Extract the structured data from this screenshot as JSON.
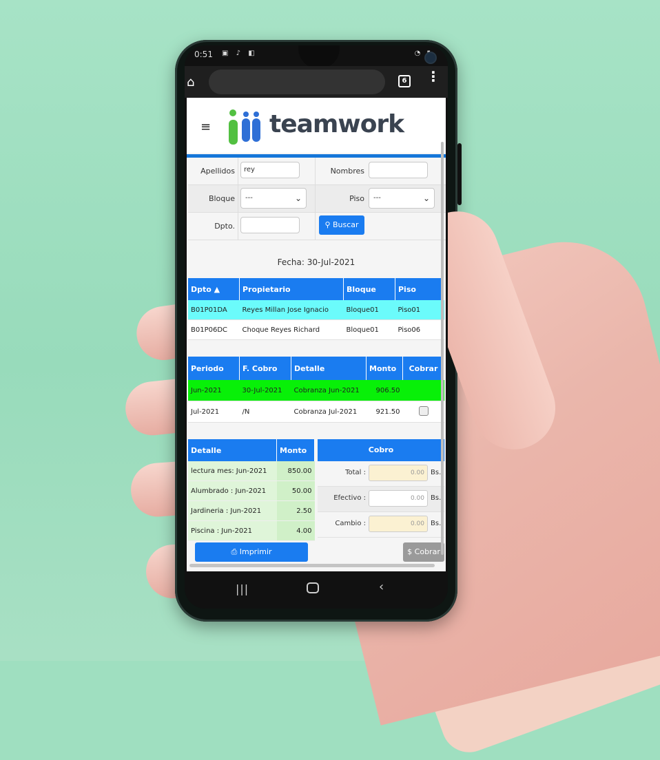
{
  "status": {
    "time": "0:51",
    "notif_icons": "▣ ♪ ◧",
    "right_icons": "◔ ▮"
  },
  "browser": {
    "tab_count": "6",
    "home": "⌂",
    "menu": "⋮"
  },
  "app": {
    "menu_icon": "≡",
    "brand": "teamwork",
    "accent": "#1a7cf0"
  },
  "search": {
    "apellidos_label": "Apellidos",
    "apellidos_value": "rey",
    "nombres_label": "Nombres",
    "nombres_value": "",
    "bloque_label": "Bloque",
    "bloque_value": "---",
    "piso_label": "Piso",
    "piso_value": "---",
    "dpto_label": "Dpto.",
    "dpto_value": "",
    "buscar_label": "Buscar"
  },
  "fecha": "Fecha: 30-Jul-2021",
  "owners_table": {
    "headers": [
      "Dpto ▲",
      "Propietario",
      "Bloque",
      "Piso"
    ],
    "rows": [
      [
        "B01P01DA",
        "Reyes Millan Jose Ignacio",
        "Bloque01",
        "Piso01"
      ],
      [
        "B01P06DC",
        "Choque Reyes Richard",
        "Bloque01",
        "Piso06"
      ]
    ]
  },
  "periods_table": {
    "headers": [
      "Periodo",
      "F. Cobro",
      "Detalle",
      "Monto",
      "Cobrar"
    ],
    "rows": [
      [
        "Jun-2021",
        "30-Jul-2021",
        "Cobranza Jun-2021",
        "906.50",
        ""
      ],
      [
        "Jul-2021",
        "/N",
        "Cobranza Jul-2021",
        "921.50",
        ""
      ]
    ]
  },
  "detail_table": {
    "headers": [
      "Detalle",
      "Monto"
    ],
    "rows": [
      [
        "lectura mes: Jun-2021",
        "850.00"
      ],
      [
        "Alumbrado : Jun-2021",
        "50.00"
      ],
      [
        "Jardineria : Jun-2021",
        "2.50"
      ],
      [
        "Piscina : Jun-2021",
        "4.00"
      ]
    ]
  },
  "cobro": {
    "title": "Cobro",
    "total_label": "Total :",
    "total_value": "0.00",
    "efectivo_label": "Efectivo :",
    "efectivo_value": "0.00",
    "cambio_label": "Cambio :",
    "cambio_value": "0.00",
    "unit": "Bs."
  },
  "buttons": {
    "imprimir": "Imprimir",
    "cobrar": "Cobrar"
  },
  "nav": {
    "recent": "|||",
    "back": "‹"
  }
}
